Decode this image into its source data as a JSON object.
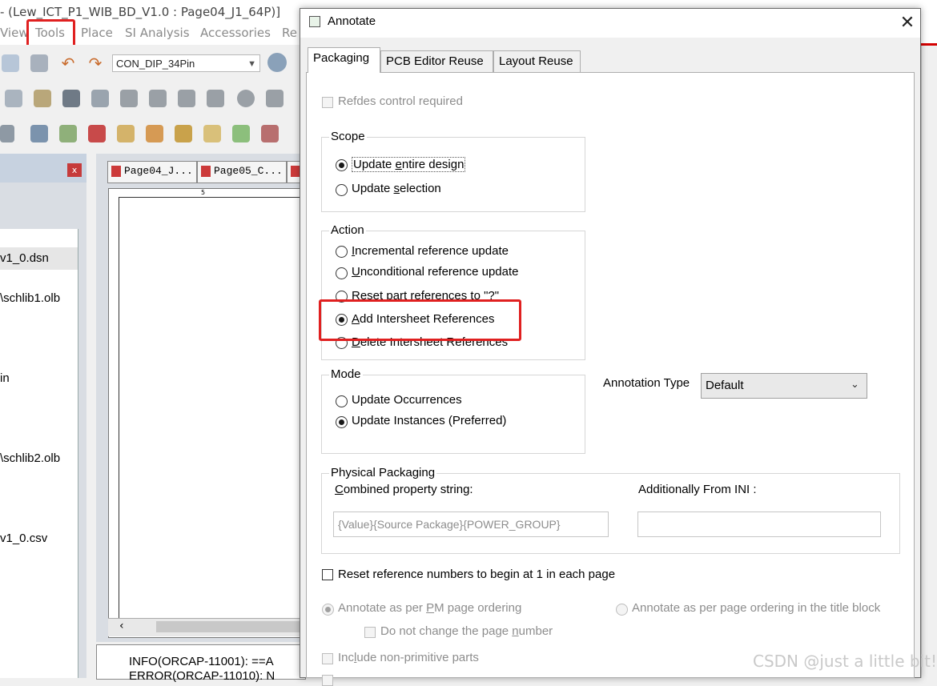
{
  "app": {
    "title": "- (Lew_ICT_P1_WIB_BD_V1.0 : Page04_J1_64P)]",
    "menu": [
      "View",
      "Tools",
      "Place",
      "SI Analysis",
      "Accessories",
      "Re"
    ],
    "part_combo_value": "CON_DIP_34Pin",
    "project_panel_close": "x",
    "project_tree": [
      "v1_0.dsn",
      "\\schlib1.olb",
      "in",
      "\\schlib2.olb",
      "v1_0.csv"
    ],
    "doc_tabs": [
      "Page04_J...",
      "Page05_C..."
    ],
    "ruler_mark": "5",
    "log_lines": [
      "INFO(ORCAP-11001): ==A",
      "ERROR(ORCAP-11010): N"
    ],
    "highlight_color": "#e02020"
  },
  "dialog": {
    "title": "Annotate",
    "close_glyph": "✕",
    "tabs": [
      {
        "label": "Packaging",
        "active": true
      },
      {
        "label": "PCB Editor Reuse",
        "active": false
      },
      {
        "label": "Layout Reuse",
        "active": false
      }
    ],
    "refdes_control": {
      "label": "Refdes control required",
      "checked": false,
      "enabled": false
    },
    "scope": {
      "title": "Scope",
      "options": [
        {
          "label": "Update entire design",
          "selected": true
        },
        {
          "label": "Update selection",
          "selected": false
        }
      ]
    },
    "action": {
      "title": "Action",
      "options": [
        {
          "label": "Incremental reference update",
          "selected": false
        },
        {
          "label": "Unconditional reference update",
          "selected": false
        },
        {
          "label": "Reset part references to \"?\"",
          "selected": false
        },
        {
          "label": "Add Intersheet References",
          "selected": true
        },
        {
          "label": "Delete Intersheet References",
          "selected": false
        }
      ]
    },
    "mode": {
      "title": "Mode",
      "options": [
        {
          "label": "Update Occurrences",
          "selected": false
        },
        {
          "label": "Update Instances (Preferred)",
          "selected": true
        }
      ]
    },
    "annotation_type": {
      "label": "Annotation Type",
      "value": "Default"
    },
    "physical_packaging": {
      "title": "Physical Packaging",
      "combined_label": "Combined property string:",
      "combined_value": "{Value}{Source Package}{POWER_GROUP}",
      "ini_label": "Additionally From INI :",
      "ini_value": ""
    },
    "reset_refnums": {
      "label": "Reset reference numbers to begin at 1 in each page",
      "checked": false
    },
    "ordering": [
      {
        "label": "Annotate as per PM page ordering",
        "selected": true,
        "enabled": false
      },
      {
        "label": "Annotate as per page ordering in the title block",
        "selected": false,
        "enabled": false
      }
    ],
    "do_not_change_page": {
      "label": "Do not change the page number",
      "checked": false,
      "enabled": false
    },
    "include_non_primitive": {
      "label": "Include non-primitive parts",
      "checked": false,
      "enabled": false
    }
  },
  "watermark": "CSDN @just a little bit!"
}
